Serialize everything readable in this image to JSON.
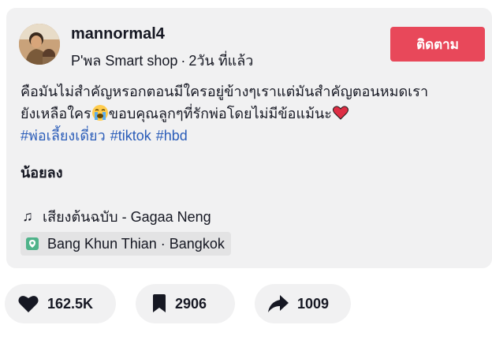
{
  "author": {
    "username": "mannormal4",
    "display_name": "P'พล Smart shop",
    "separator": "·",
    "posted_time": "2วัน ที่แล้ว"
  },
  "follow_button": {
    "label": "ติดตาม"
  },
  "caption": {
    "line1": "คือมันไม่สำคัญหรอกตอนมีใครอยู่ข้างๆเราแต่มันสำคัญตอนหมดเรา",
    "line2_before_emoji": "ยังเหลือใคร",
    "line2_after_emoji": "ขอบคุณลูกๆที่รักพ่อโดยไม่มีข้อแม้นะ",
    "hashtags": [
      "#พ่อเลี้ยงเดี่ยว",
      "#tiktok",
      "#hbd"
    ]
  },
  "extra_text": "น้อยลง",
  "music": {
    "icon": "music-note-icon",
    "title": "เสียงต้นฉบับ - Gagaa Neng"
  },
  "location": {
    "icon": "location-pin-icon",
    "label": "Bang Khun Thian · Bangkok"
  },
  "actions": {
    "likes": "162.5K",
    "saves": "2906",
    "shares": "1009"
  },
  "colors": {
    "follow_button": "#e8485a",
    "hashtag": "#2b5db9",
    "card_background": "#f1f1f2",
    "location_pin": "#4fb38a"
  }
}
